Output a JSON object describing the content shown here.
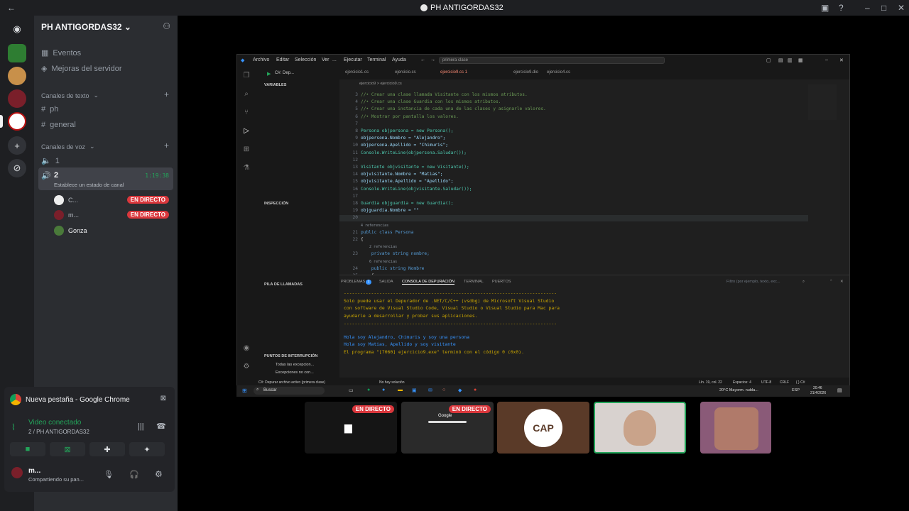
{
  "window": {
    "title": "PH ANTIGORDAS32"
  },
  "server": {
    "name": "PH ANTIGORDAS32"
  },
  "sidebar": {
    "events": "Eventos",
    "boosts": "Mejoras del servidor",
    "text_category": "Canales de texto",
    "text_channels": [
      "ph",
      "general"
    ],
    "voice_category": "Canales de voz",
    "voice_channels": [
      {
        "name": "1"
      },
      {
        "name": "2",
        "timer": "1:19:38",
        "status": "Establece un estado de canal"
      }
    ],
    "voice_users": [
      {
        "name": "C...",
        "badge": "EN DIRECTO"
      },
      {
        "name": "m...",
        "badge": "EN DIRECTO"
      },
      {
        "name": "Gonza",
        "badge": ""
      }
    ]
  },
  "popup": {
    "title": "Nueva pestaña - Google Chrome"
  },
  "voice_panel": {
    "status": "Video conectado",
    "location": "2 / PH ANTIGORDAS32",
    "user_name": "m...",
    "user_status": "Compartiendo su pan..."
  },
  "vscode": {
    "menu": [
      "Archivo",
      "Editar",
      "Selección",
      "Ver",
      "...",
      "Ejecutar",
      "Terminal",
      "Ayuda"
    ],
    "search": "primera clase",
    "debug_config": "C#: Dep...",
    "tabs": [
      "ejercicio1.cs",
      "ejercicio.cs",
      "ejercicio9.cs 1",
      "ejercicio9.dio",
      "ejercicio4.cs"
    ],
    "breadcrumb": "ejercicio9 > ejercicio9.cs",
    "side_sections": {
      "variables": "VARIABLES",
      "inspection": "INSPECCIÓN",
      "callstack": "PILA DE LLAMADAS",
      "breakpoints": "PUNTOS DE INTERRUPCIÓN",
      "bp_items": [
        "Todas las excepcion...",
        "Excepciones no con..."
      ]
    },
    "code_lines": [
      {
        "n": "3",
        "t": "//• Crear una clase llamada Visitante con los mismos atributos."
      },
      {
        "n": "4",
        "t": "//• Crear una clase Guardia con los mismos atributos."
      },
      {
        "n": "5",
        "t": "//• Crear una instancia de cada una de las clases y asignarle valores."
      },
      {
        "n": "6",
        "t": "//• Mostrar por pantalla los valores."
      },
      {
        "n": "7",
        "t": ""
      },
      {
        "n": "8",
        "t": "Persona objpersona = new Persona();"
      },
      {
        "n": "9",
        "t": "objpersona.Nombre = \"Alejandro\";"
      },
      {
        "n": "10",
        "t": "objpersona.Apellido = \"Chimuris\";"
      },
      {
        "n": "11",
        "t": "Console.WriteLine(objpersona.Saludar());"
      },
      {
        "n": "12",
        "t": ""
      },
      {
        "n": "13",
        "t": "Visitante objvisitante = new Visitante();"
      },
      {
        "n": "14",
        "t": "objvisitante.Nombre = \"Matias\";"
      },
      {
        "n": "15",
        "t": "objvisitante.Apellido = \"Apellido\";"
      },
      {
        "n": "16",
        "t": "Console.WriteLine(objvisitante.Saludar());"
      },
      {
        "n": "17",
        "t": ""
      },
      {
        "n": "18",
        "t": "Guardia objguardia = new Guardia();"
      },
      {
        "n": "19",
        "t": "objguardia.Nombre = \"\""
      },
      {
        "n": "20",
        "t": ""
      },
      {
        "n": "",
        "t": "4 referencias"
      },
      {
        "n": "21",
        "t": "public class Persona"
      },
      {
        "n": "22",
        "t": "{"
      },
      {
        "n": "",
        "t": "    2 referencias"
      },
      {
        "n": "23",
        "t": "    private string nombre;"
      },
      {
        "n": "",
        "t": "    6 referencias"
      },
      {
        "n": "24",
        "t": "    public string Nombre"
      },
      {
        "n": "25",
        "t": "    {"
      }
    ],
    "panel_tabs": [
      "PROBLEMAS",
      "SALIDA",
      "CONSOLA DE DEPURACIÓN",
      "TERMINAL",
      "PUERTOS"
    ],
    "problems_count": "1",
    "filter_placeholder": "Filtro (por ejemplo, texto, exc...",
    "console_lines": [
      {
        "t": "------------------------------------------------------------------------------",
        "c": "#cca700"
      },
      {
        "t": "Solo puede usar el Depurador de .NET/C/C++ (vsdbg) de Microsoft Visual Studio",
        "c": "#cca700"
      },
      {
        "t": "con software de Visual Studio Code, Visual Studio o Visual Studio para Mac para",
        "c": "#cca700"
      },
      {
        "t": "ayudarle a desarrollar y probar sus aplicaciones.",
        "c": "#cca700"
      },
      {
        "t": "------------------------------------------------------------------------------",
        "c": "#cca700"
      },
      {
        "t": "Hola soy Alejandro, Chimuris y soy una persona",
        "c": "#3794ff"
      },
      {
        "t": "Hola soy Matias, Apellido y soy visitante",
        "c": "#3794ff"
      },
      {
        "t": "El programa \"[7060] ejercicio9.exe\" terminó con el código 0 (0x0).",
        "c": "#cca700"
      }
    ],
    "status_left": "C#: Depurar archivo activo (primera clase)",
    "status_left2": "No hay solución",
    "status_right": [
      "Lín. 19, col. 22",
      "Espacios: 4",
      "UTF-8",
      "CRLF",
      "{ } C#"
    ]
  },
  "taskbar": {
    "search": "Buscar",
    "weather": "20°C Mayorm. nubla...",
    "lang": "ESP",
    "time": "20:46",
    "date": "21/4/2026"
  },
  "tiles": [
    {
      "badge": "EN DIRECTO"
    },
    {
      "badge": "EN DIRECTO",
      "label": "Google"
    },
    {
      "badge": "",
      "logo": "CAP"
    },
    {
      "badge": ""
    },
    {
      "badge": ""
    }
  ],
  "colors": {
    "discord_bg": "#2b2d31",
    "live": "#da373c",
    "vscode_bg": "#1f1f1f",
    "accent_green": "#23a55a"
  }
}
